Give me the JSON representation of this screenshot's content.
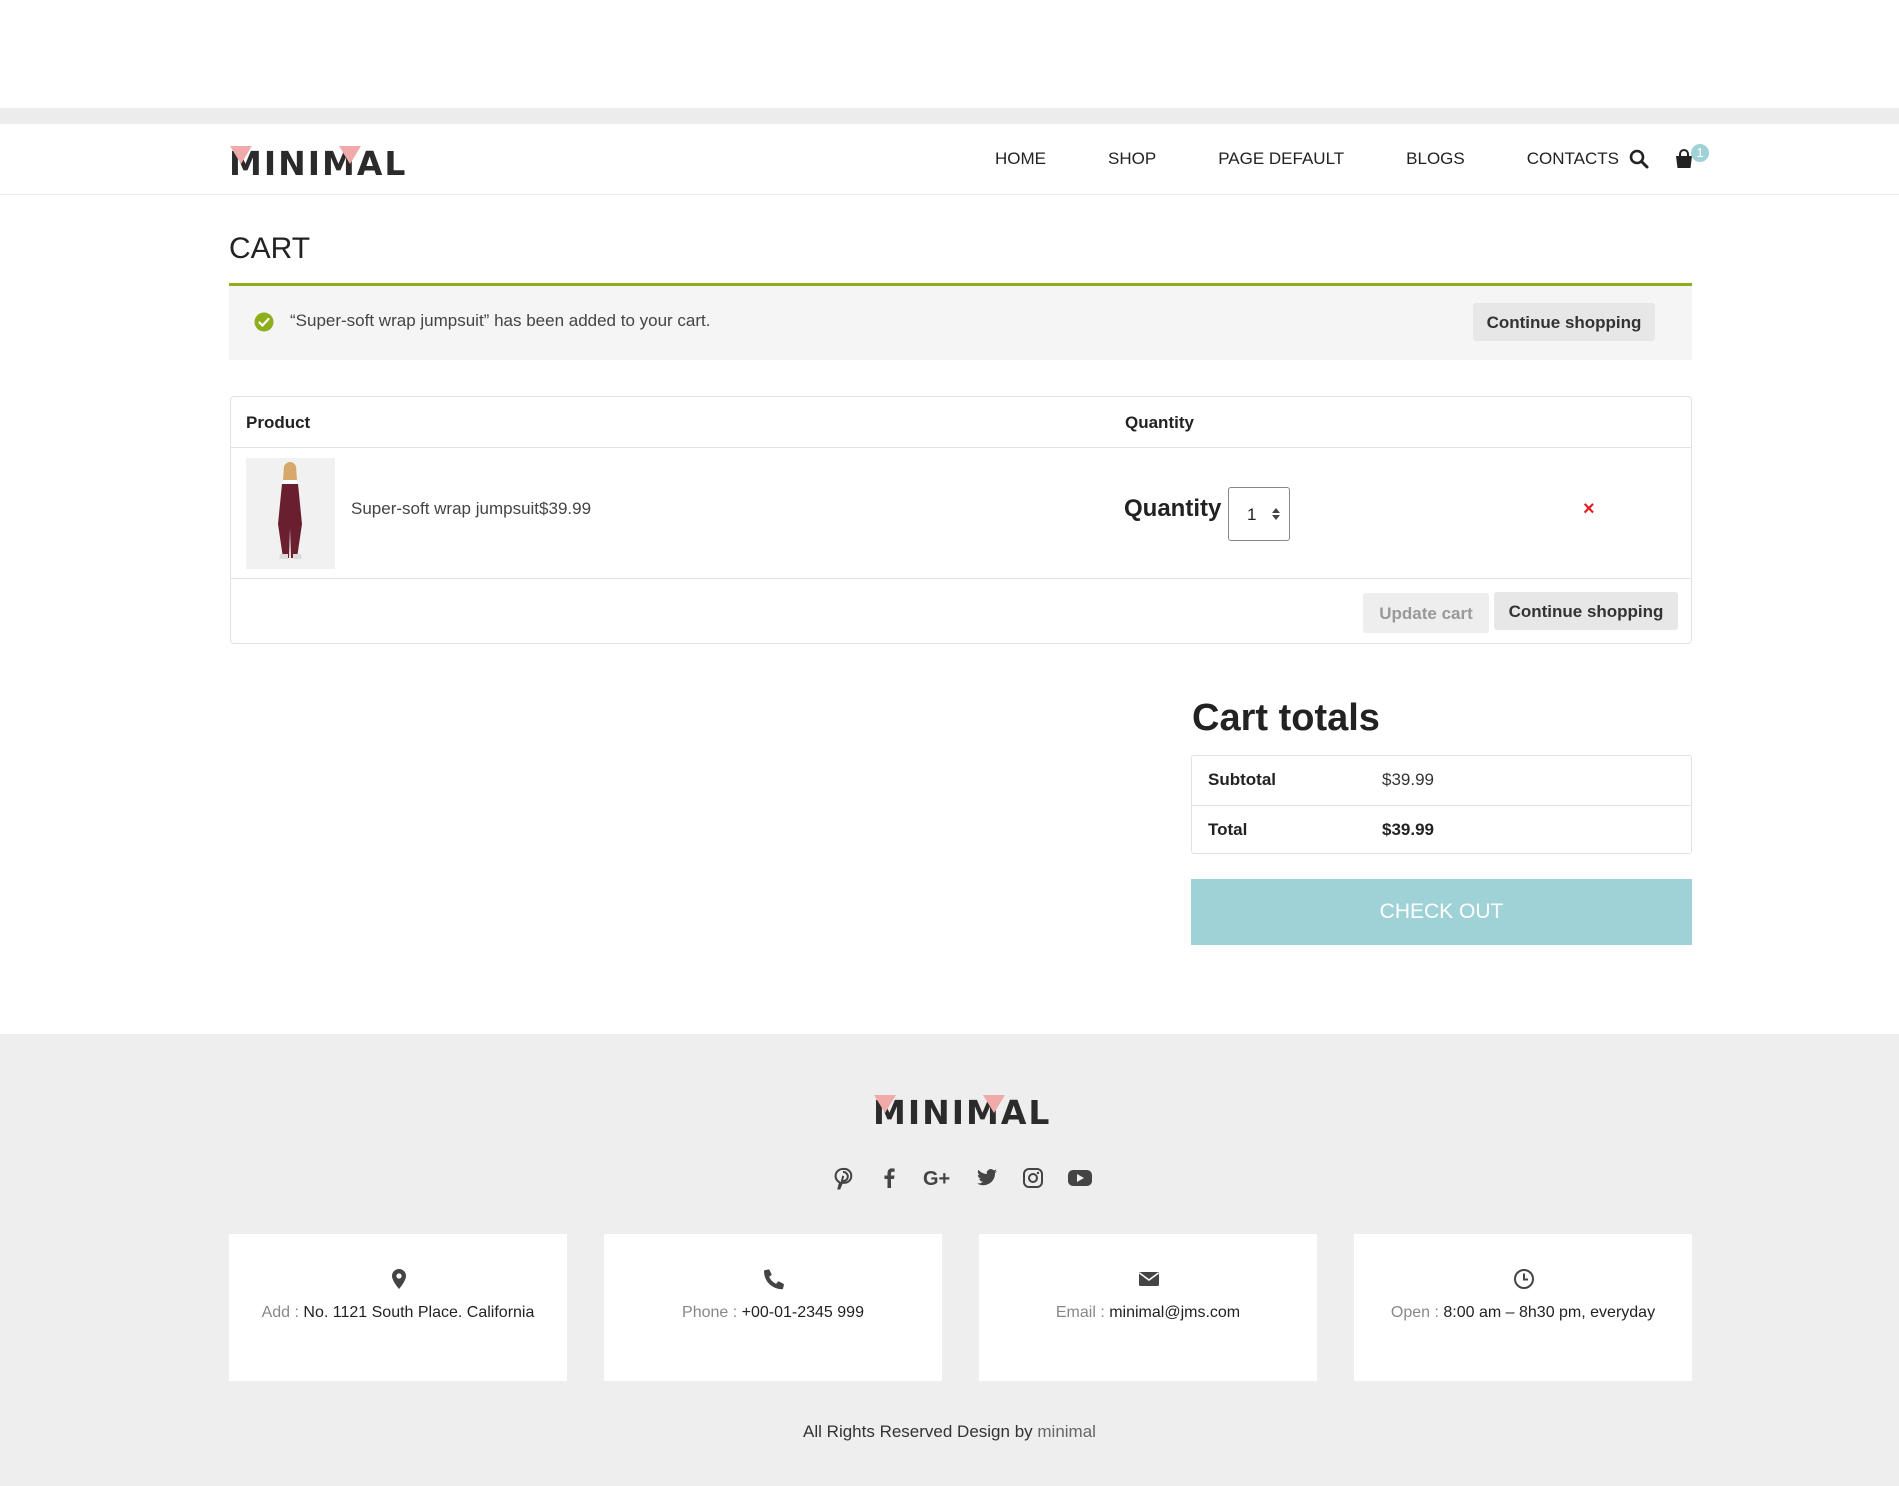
{
  "header": {
    "logo_text": "MINIMAL",
    "nav": [
      "HOME",
      "SHOP",
      "PAGE DEFAULT",
      "BLOGS",
      "CONTACTS"
    ],
    "cart_count": "1",
    "icons": [
      "search-icon",
      "shopping-bag-icon"
    ]
  },
  "page": {
    "title": "CART"
  },
  "notice": {
    "message": "“Super-soft wrap jumpsuit” has been added to your cart.",
    "continue_label": "Continue shopping"
  },
  "cart": {
    "columns": {
      "product": "Product",
      "quantity": "Quantity"
    },
    "items": [
      {
        "name": "Super-soft wrap jumpsuit",
        "price": "$39.99",
        "quantity_label": "Quantity",
        "quantity": "1",
        "remove": "×"
      }
    ],
    "update_label": "Update cart",
    "continue_label": "Continue shopping"
  },
  "totals": {
    "title": "Cart totals",
    "subtotal_label": "Subtotal",
    "subtotal_value": "$39.99",
    "total_label": "Total",
    "total_value": "$39.99",
    "checkout_label": "CHECK OUT"
  },
  "footer": {
    "logo_text": "MINIMAL",
    "social_icons": [
      "pinterest-icon",
      "facebook-icon",
      "google-plus-icon",
      "twitter-icon",
      "instagram-icon",
      "youtube-icon"
    ],
    "info": [
      {
        "icon": "map-pin-icon",
        "label": "Add :",
        "value": "No. 1121 South Place. California"
      },
      {
        "icon": "phone-icon",
        "label": "Phone :",
        "value": "+00-01-2345 999"
      },
      {
        "icon": "envelope-icon",
        "label": "Email :",
        "value": "minimal@jms.com"
      },
      {
        "icon": "clock-icon",
        "label": "Open :",
        "value": "8:00 am – 8h30 pm, everyday"
      }
    ],
    "copyright_prefix": "All Rights Reserved Design by",
    "copyright_brand": "minimal"
  },
  "colors": {
    "accent": "#9fd2d6",
    "notice_border": "#8fae1b",
    "remove": "#e01f1f",
    "logo_triangle": "#f0aaa9"
  }
}
